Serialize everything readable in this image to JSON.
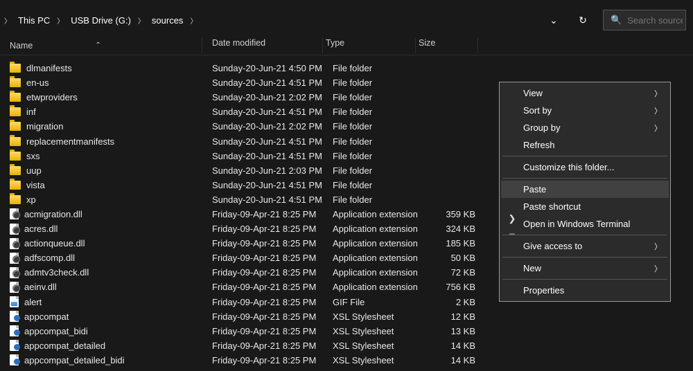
{
  "breadcrumb": [
    "This PC",
    "USB Drive (G:)",
    "sources"
  ],
  "search": {
    "placeholder": "Search sources"
  },
  "columns": {
    "name": "Name",
    "date": "Date modified",
    "type": "Type",
    "size": "Size"
  },
  "rows": [
    {
      "icon": "folder",
      "name": "dlmanifests",
      "date": "Sunday-20-Jun-21 4:50 PM",
      "type": "File folder",
      "size": ""
    },
    {
      "icon": "folder",
      "name": "en-us",
      "date": "Sunday-20-Jun-21 4:51 PM",
      "type": "File folder",
      "size": ""
    },
    {
      "icon": "folder",
      "name": "etwproviders",
      "date": "Sunday-20-Jun-21 2:02 PM",
      "type": "File folder",
      "size": ""
    },
    {
      "icon": "folder",
      "name": "inf",
      "date": "Sunday-20-Jun-21 4:51 PM",
      "type": "File folder",
      "size": ""
    },
    {
      "icon": "folder",
      "name": "migration",
      "date": "Sunday-20-Jun-21 2:02 PM",
      "type": "File folder",
      "size": ""
    },
    {
      "icon": "folder",
      "name": "replacementmanifests",
      "date": "Sunday-20-Jun-21 4:51 PM",
      "type": "File folder",
      "size": ""
    },
    {
      "icon": "folder",
      "name": "sxs",
      "date": "Sunday-20-Jun-21 4:51 PM",
      "type": "File folder",
      "size": ""
    },
    {
      "icon": "folder",
      "name": "uup",
      "date": "Sunday-20-Jun-21 2:03 PM",
      "type": "File folder",
      "size": ""
    },
    {
      "icon": "folder",
      "name": "vista",
      "date": "Sunday-20-Jun-21 4:51 PM",
      "type": "File folder",
      "size": ""
    },
    {
      "icon": "folder",
      "name": "xp",
      "date": "Sunday-20-Jun-21 4:51 PM",
      "type": "File folder",
      "size": ""
    },
    {
      "icon": "dll",
      "name": "acmigration.dll",
      "date": "Friday-09-Apr-21 8:25 PM",
      "type": "Application extension",
      "size": "359 KB"
    },
    {
      "icon": "dll",
      "name": "acres.dll",
      "date": "Friday-09-Apr-21 8:25 PM",
      "type": "Application extension",
      "size": "324 KB"
    },
    {
      "icon": "dll",
      "name": "actionqueue.dll",
      "date": "Friday-09-Apr-21 8:25 PM",
      "type": "Application extension",
      "size": "185 KB"
    },
    {
      "icon": "dll",
      "name": "adfscomp.dll",
      "date": "Friday-09-Apr-21 8:25 PM",
      "type": "Application extension",
      "size": "50 KB"
    },
    {
      "icon": "dll",
      "name": "admtv3check.dll",
      "date": "Friday-09-Apr-21 8:25 PM",
      "type": "Application extension",
      "size": "72 KB"
    },
    {
      "icon": "dll",
      "name": "aeinv.dll",
      "date": "Friday-09-Apr-21 8:25 PM",
      "type": "Application extension",
      "size": "756 KB"
    },
    {
      "icon": "gif",
      "name": "alert",
      "date": "Friday-09-Apr-21 8:25 PM",
      "type": "GIF File",
      "size": "2 KB"
    },
    {
      "icon": "xsl",
      "name": "appcompat",
      "date": "Friday-09-Apr-21 8:25 PM",
      "type": "XSL Stylesheet",
      "size": "12 KB"
    },
    {
      "icon": "xsl",
      "name": "appcompat_bidi",
      "date": "Friday-09-Apr-21 8:25 PM",
      "type": "XSL Stylesheet",
      "size": "13 KB"
    },
    {
      "icon": "xsl",
      "name": "appcompat_detailed",
      "date": "Friday-09-Apr-21 8:25 PM",
      "type": "XSL Stylesheet",
      "size": "14 KB"
    },
    {
      "icon": "xsl",
      "name": "appcompat_detailed_bidi",
      "date": "Friday-09-Apr-21 8:25 PM",
      "type": "XSL Stylesheet",
      "size": "14 KB"
    }
  ],
  "context_menu": {
    "view": "View",
    "sort_by": "Sort by",
    "group_by": "Group by",
    "refresh": "Refresh",
    "customize": "Customize this folder...",
    "paste": "Paste",
    "paste_shortcut": "Paste shortcut",
    "open_terminal": "Open in Windows Terminal",
    "give_access": "Give access to",
    "new": "New",
    "properties": "Properties"
  }
}
